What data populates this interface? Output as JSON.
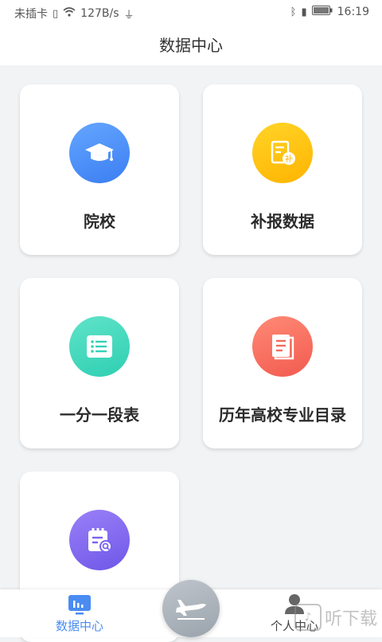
{
  "status_bar": {
    "carrier": "未插卡",
    "speed": "127B/s",
    "time": "16:19"
  },
  "header": {
    "title": "数据中心"
  },
  "cards": [
    {
      "label": "院校",
      "icon": "graduation-cap-icon",
      "color": "#4a8cf6"
    },
    {
      "label": "补报数据",
      "icon": "supplement-document-icon",
      "color": "#ffc20e"
    },
    {
      "label": "一分一段表",
      "icon": "list-icon",
      "color": "#3fd8bd"
    },
    {
      "label": "历年高校专业目录",
      "icon": "book-icon",
      "color": "#f66c5f"
    },
    {
      "label": "",
      "icon": "calendar-search-icon",
      "color": "#7e66f0"
    }
  ],
  "bottom_nav": {
    "data_center": "数据中心",
    "personal_center": "个人中心",
    "active_color": "#4a8cf2"
  },
  "watermark": {
    "text": "听下载"
  }
}
